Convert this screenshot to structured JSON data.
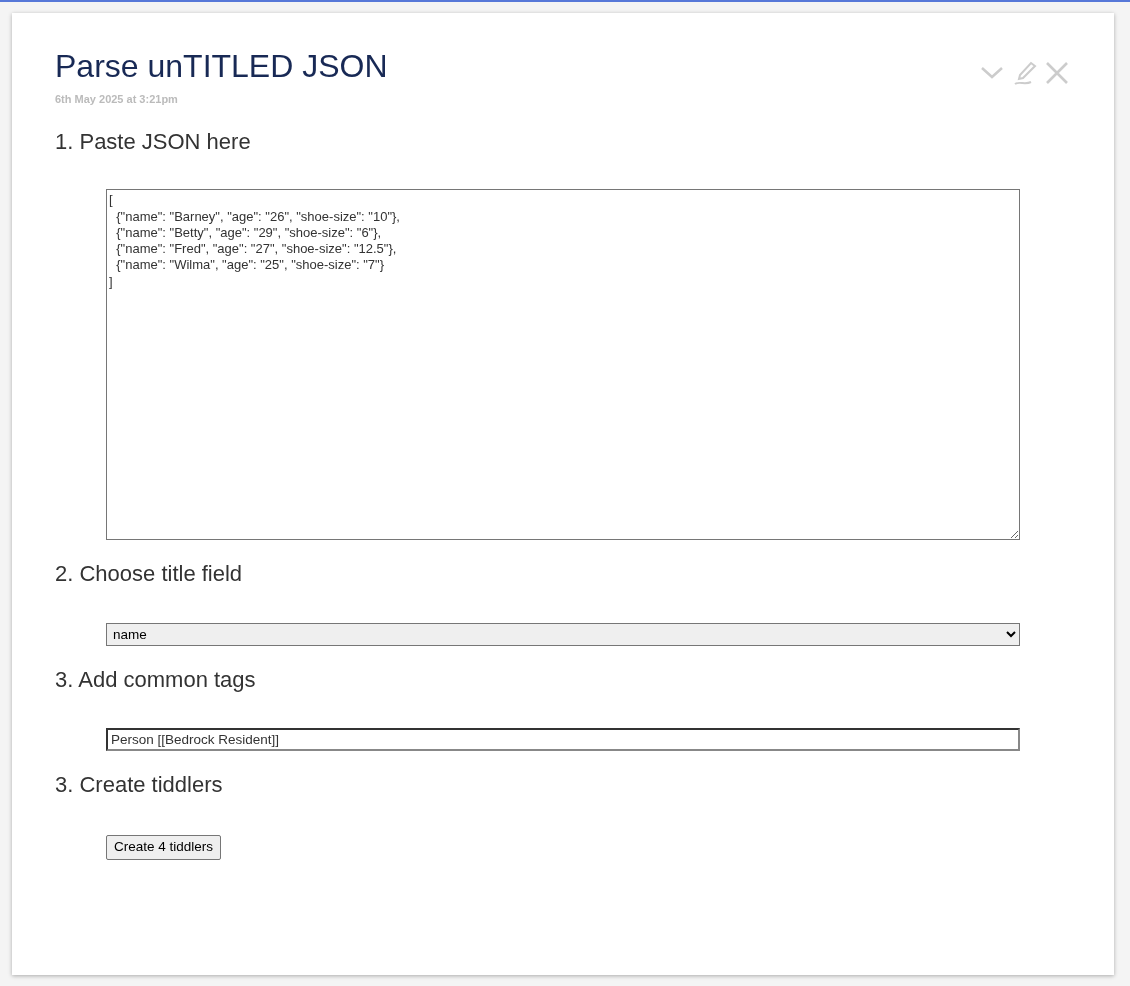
{
  "tiddler": {
    "title": "Parse unTITLED JSON",
    "subtitle": "6th May 2025 at 3:21pm",
    "toolbar": [
      {
        "kind": "fold"
      },
      {
        "kind": "edit"
      },
      {
        "kind": "close"
      }
    ]
  },
  "steps": [
    {
      "heading": "1. Paste JSON here",
      "kind": "textarea",
      "value": "[\n  {\"name\": \"Barney\", \"age\": \"26\", \"shoe-size\": \"10\"},\n  {\"name\": \"Betty\", \"age\": \"29\", \"shoe-size\": \"6\"},\n  {\"name\": \"Fred\", \"age\": \"27\", \"shoe-size\": \"12.5\"},\n  {\"name\": \"Wilma\", \"age\": \"25\", \"shoe-size\": \"7\"}\n]"
    },
    {
      "heading": "2. Choose title field",
      "kind": "select",
      "value": "name"
    },
    {
      "heading": "3. Add common tags",
      "kind": "text",
      "value": "Person [[Bedrock Resident]]"
    },
    {
      "heading": "3. Create tiddlers",
      "kind": "button",
      "value": "Create 4 tiddlers"
    }
  ]
}
